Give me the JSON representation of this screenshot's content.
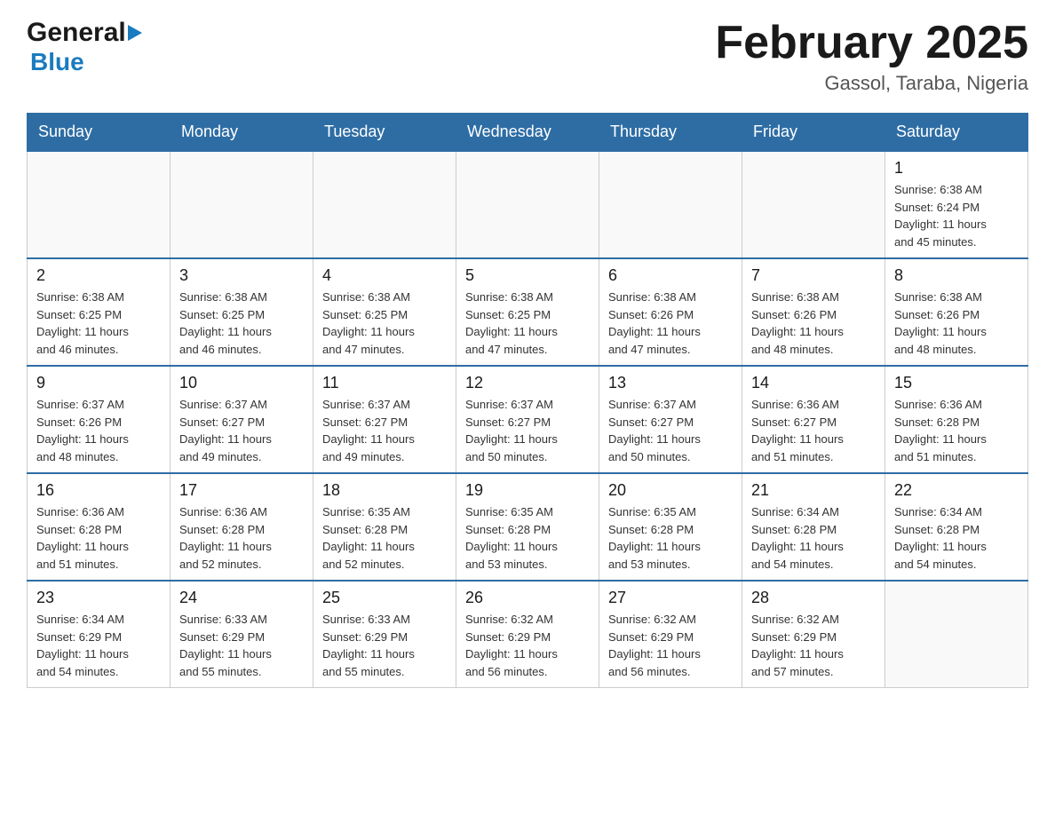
{
  "header": {
    "logo_general": "General",
    "logo_blue": "Blue",
    "title": "February 2025",
    "location": "Gassol, Taraba, Nigeria"
  },
  "days_of_week": [
    "Sunday",
    "Monday",
    "Tuesday",
    "Wednesday",
    "Thursday",
    "Friday",
    "Saturday"
  ],
  "weeks": [
    {
      "days": [
        {
          "number": "",
          "info": ""
        },
        {
          "number": "",
          "info": ""
        },
        {
          "number": "",
          "info": ""
        },
        {
          "number": "",
          "info": ""
        },
        {
          "number": "",
          "info": ""
        },
        {
          "number": "",
          "info": ""
        },
        {
          "number": "1",
          "info": "Sunrise: 6:38 AM\nSunset: 6:24 PM\nDaylight: 11 hours\nand 45 minutes."
        }
      ]
    },
    {
      "days": [
        {
          "number": "2",
          "info": "Sunrise: 6:38 AM\nSunset: 6:25 PM\nDaylight: 11 hours\nand 46 minutes."
        },
        {
          "number": "3",
          "info": "Sunrise: 6:38 AM\nSunset: 6:25 PM\nDaylight: 11 hours\nand 46 minutes."
        },
        {
          "number": "4",
          "info": "Sunrise: 6:38 AM\nSunset: 6:25 PM\nDaylight: 11 hours\nand 47 minutes."
        },
        {
          "number": "5",
          "info": "Sunrise: 6:38 AM\nSunset: 6:25 PM\nDaylight: 11 hours\nand 47 minutes."
        },
        {
          "number": "6",
          "info": "Sunrise: 6:38 AM\nSunset: 6:26 PM\nDaylight: 11 hours\nand 47 minutes."
        },
        {
          "number": "7",
          "info": "Sunrise: 6:38 AM\nSunset: 6:26 PM\nDaylight: 11 hours\nand 48 minutes."
        },
        {
          "number": "8",
          "info": "Sunrise: 6:38 AM\nSunset: 6:26 PM\nDaylight: 11 hours\nand 48 minutes."
        }
      ]
    },
    {
      "days": [
        {
          "number": "9",
          "info": "Sunrise: 6:37 AM\nSunset: 6:26 PM\nDaylight: 11 hours\nand 48 minutes."
        },
        {
          "number": "10",
          "info": "Sunrise: 6:37 AM\nSunset: 6:27 PM\nDaylight: 11 hours\nand 49 minutes."
        },
        {
          "number": "11",
          "info": "Sunrise: 6:37 AM\nSunset: 6:27 PM\nDaylight: 11 hours\nand 49 minutes."
        },
        {
          "number": "12",
          "info": "Sunrise: 6:37 AM\nSunset: 6:27 PM\nDaylight: 11 hours\nand 50 minutes."
        },
        {
          "number": "13",
          "info": "Sunrise: 6:37 AM\nSunset: 6:27 PM\nDaylight: 11 hours\nand 50 minutes."
        },
        {
          "number": "14",
          "info": "Sunrise: 6:36 AM\nSunset: 6:27 PM\nDaylight: 11 hours\nand 51 minutes."
        },
        {
          "number": "15",
          "info": "Sunrise: 6:36 AM\nSunset: 6:28 PM\nDaylight: 11 hours\nand 51 minutes."
        }
      ]
    },
    {
      "days": [
        {
          "number": "16",
          "info": "Sunrise: 6:36 AM\nSunset: 6:28 PM\nDaylight: 11 hours\nand 51 minutes."
        },
        {
          "number": "17",
          "info": "Sunrise: 6:36 AM\nSunset: 6:28 PM\nDaylight: 11 hours\nand 52 minutes."
        },
        {
          "number": "18",
          "info": "Sunrise: 6:35 AM\nSunset: 6:28 PM\nDaylight: 11 hours\nand 52 minutes."
        },
        {
          "number": "19",
          "info": "Sunrise: 6:35 AM\nSunset: 6:28 PM\nDaylight: 11 hours\nand 53 minutes."
        },
        {
          "number": "20",
          "info": "Sunrise: 6:35 AM\nSunset: 6:28 PM\nDaylight: 11 hours\nand 53 minutes."
        },
        {
          "number": "21",
          "info": "Sunrise: 6:34 AM\nSunset: 6:28 PM\nDaylight: 11 hours\nand 54 minutes."
        },
        {
          "number": "22",
          "info": "Sunrise: 6:34 AM\nSunset: 6:28 PM\nDaylight: 11 hours\nand 54 minutes."
        }
      ]
    },
    {
      "days": [
        {
          "number": "23",
          "info": "Sunrise: 6:34 AM\nSunset: 6:29 PM\nDaylight: 11 hours\nand 54 minutes."
        },
        {
          "number": "24",
          "info": "Sunrise: 6:33 AM\nSunset: 6:29 PM\nDaylight: 11 hours\nand 55 minutes."
        },
        {
          "number": "25",
          "info": "Sunrise: 6:33 AM\nSunset: 6:29 PM\nDaylight: 11 hours\nand 55 minutes."
        },
        {
          "number": "26",
          "info": "Sunrise: 6:32 AM\nSunset: 6:29 PM\nDaylight: 11 hours\nand 56 minutes."
        },
        {
          "number": "27",
          "info": "Sunrise: 6:32 AM\nSunset: 6:29 PM\nDaylight: 11 hours\nand 56 minutes."
        },
        {
          "number": "28",
          "info": "Sunrise: 6:32 AM\nSunset: 6:29 PM\nDaylight: 11 hours\nand 57 minutes."
        },
        {
          "number": "",
          "info": ""
        }
      ]
    }
  ]
}
